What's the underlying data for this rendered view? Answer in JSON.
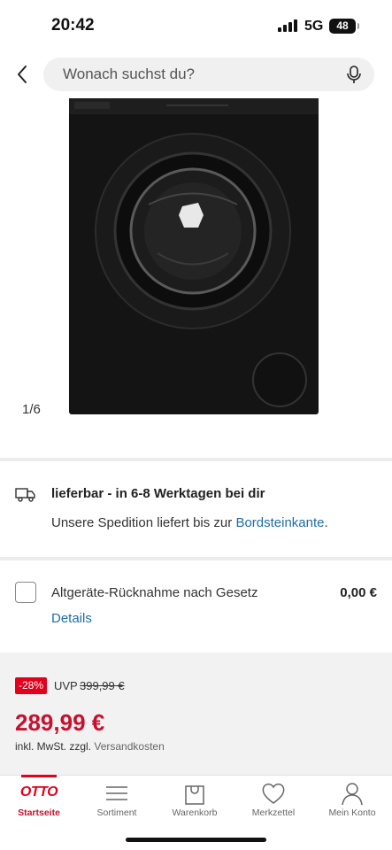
{
  "status_bar": {
    "time": "20:42",
    "network": "5G",
    "battery": "48"
  },
  "search": {
    "placeholder": "Wonach suchst du?"
  },
  "gallery": {
    "counter": "1/6"
  },
  "delivery": {
    "title": "lieferbar - in 6-8 Werktagen bei dir",
    "text_prefix": "Unsere Spedition liefert bis zur ",
    "link": "Bordsteinkante",
    "text_suffix": "."
  },
  "service": {
    "label": "Altgeräte-Rücknahme nach Gesetz",
    "price": "0,00 €",
    "details_link": "Details"
  },
  "price": {
    "discount": "-28%",
    "uvp_label": "UVP",
    "uvp_value": "399,99 €",
    "current": "289,99 €",
    "tax_prefix": "inkl. MwSt. zzgl. ",
    "tax_link": "Versandkosten"
  },
  "nav": {
    "logo": "OTTO",
    "items": [
      {
        "label": "Startseite",
        "icon": "otto-logo",
        "active": true
      },
      {
        "label": "Sortiment",
        "icon": "menu-icon",
        "active": false
      },
      {
        "label": "Warenkorb",
        "icon": "bag-icon",
        "active": false
      },
      {
        "label": "Merkzettel",
        "icon": "heart-icon",
        "active": false
      },
      {
        "label": "Mein Konto",
        "icon": "user-icon",
        "active": false
      }
    ]
  },
  "colors": {
    "brand_red": "#e3001b",
    "price_red": "#c8102e",
    "link_blue": "#1f6ea6"
  }
}
